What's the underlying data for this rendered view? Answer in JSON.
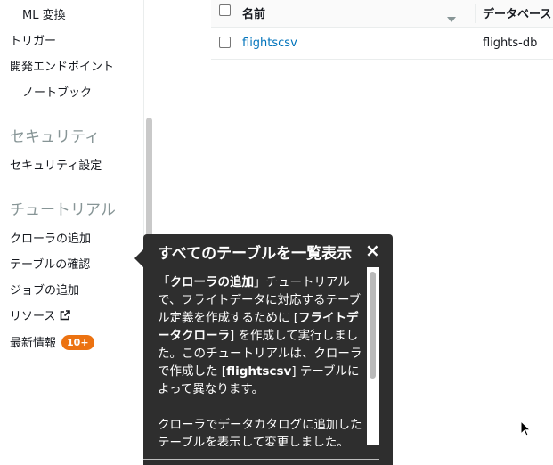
{
  "sidebar": {
    "items": [
      {
        "label": "ML 変換"
      },
      {
        "label": "トリガー"
      },
      {
        "label": "開発エンドポイント"
      },
      {
        "label": "ノートブック"
      }
    ],
    "security_heading": "セキュリティ",
    "security_items": [
      {
        "label": "セキュリティ設定"
      }
    ],
    "tutorial_heading": "チュートリアル",
    "tutorial_items": [
      {
        "label": "クローラの追加"
      },
      {
        "label": "テーブルの確認"
      },
      {
        "label": "ジョブの追加"
      }
    ],
    "resources_label": "リソース",
    "whats_new_label": "最新情報",
    "whats_new_badge": "10+"
  },
  "table": {
    "columns": [
      "名前",
      "データベース"
    ],
    "rows": [
      {
        "name": "flightscsv",
        "database": "flights-db"
      }
    ]
  },
  "popover": {
    "title": "すべてのテーブルを一覧表示",
    "close": "×",
    "p1_a": "「",
    "p1_b": "クローラの追加",
    "p1_c": "」チュートリアルで、フライトデータに対応するテーブル定義を作成するために [",
    "p1_d": "フライトデータクローラ",
    "p1_e": "] を作成して実行しました。このチュートリアルは、クローラで作成した [",
    "p1_f": "flightscsv",
    "p1_g": "] テーブルによって異なります。",
    "p2": "クローラでデータカタログに追加したテーブルを表示して変更しました。"
  },
  "colors": {
    "link": "#0073bb",
    "badge": "#ec7211",
    "popover_bg": "#2e2e2e",
    "heading": "#879596"
  }
}
